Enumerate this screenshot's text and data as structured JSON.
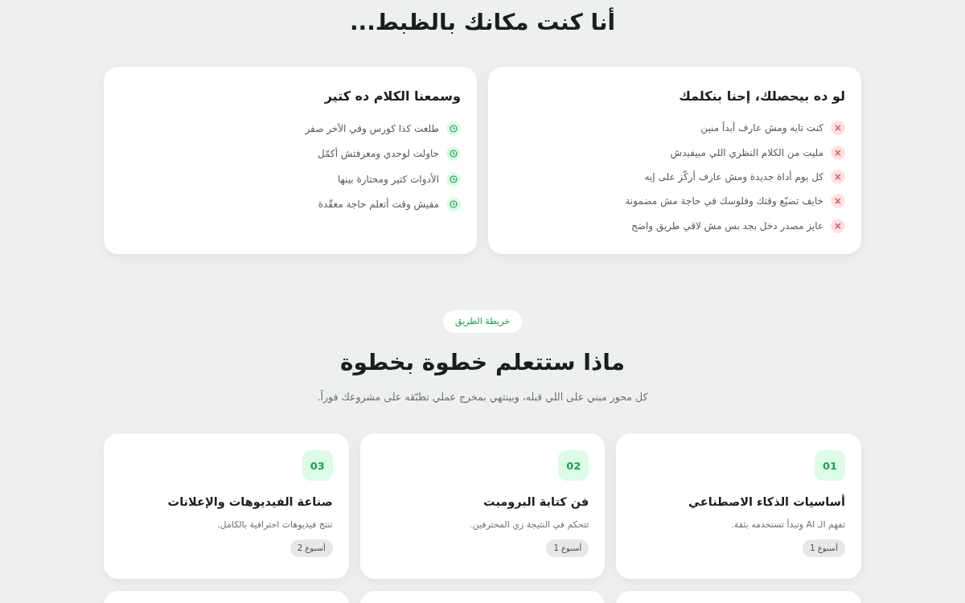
{
  "intro": {
    "title": "أنا كنت مكانك بالظبط..."
  },
  "pain_cards": [
    {
      "kind": "problem",
      "title": "لو ده بيحصلك، إحنا بنكلمك",
      "items": [
        "كنت تايه ومش عارف أبدأ منين",
        "مليت من الكلام النظري اللي مبيفيدش",
        "كل يوم أداة جديدة ومش عارف أركّز على إيه",
        "خايف تضيّع وقتك وفلوسك في حاجة مش مضمونة",
        "عايز مصدر دخل بجد بس مش لاقي طريق واضح"
      ]
    },
    {
      "kind": "heard",
      "title": "وسمعنا الكلام ده كتير",
      "items": [
        "طلعت كذا كورس وفي الآخر صفر",
        "حاولت لوحدي ومعرفتش أكمّل",
        "الأدوات كتير ومحتارة بينها",
        "مفيش وقت أتعلم حاجة معقّدة"
      ]
    }
  ],
  "roadmap": {
    "badge": "خريطة الطريق",
    "title": "ماذا ستتعلم خطوة بخطوة",
    "subtitle": "كل محور مبني على اللي قبله، وبينتهي بمخرج عملي تطبّقه على مشروعك فوراً."
  },
  "modules": [
    {
      "number": "01",
      "title": "أساسيات الذكاء الاصطناعي",
      "description": "تفهم الـ AI وتبدأ تستخدمه بثقة.",
      "duration": "أسبوع 1"
    },
    {
      "number": "02",
      "title": "فن كتابة البرومبت",
      "description": "تتحكم في النتيجة زي المحترفين.",
      "duration": "أسبوع 1"
    },
    {
      "number": "03",
      "title": "صناعة الفيديوهات والإعلانات",
      "description": "تنتج فيديوهات احترافية بالكامل.",
      "duration": "أسبوع 2"
    }
  ]
}
